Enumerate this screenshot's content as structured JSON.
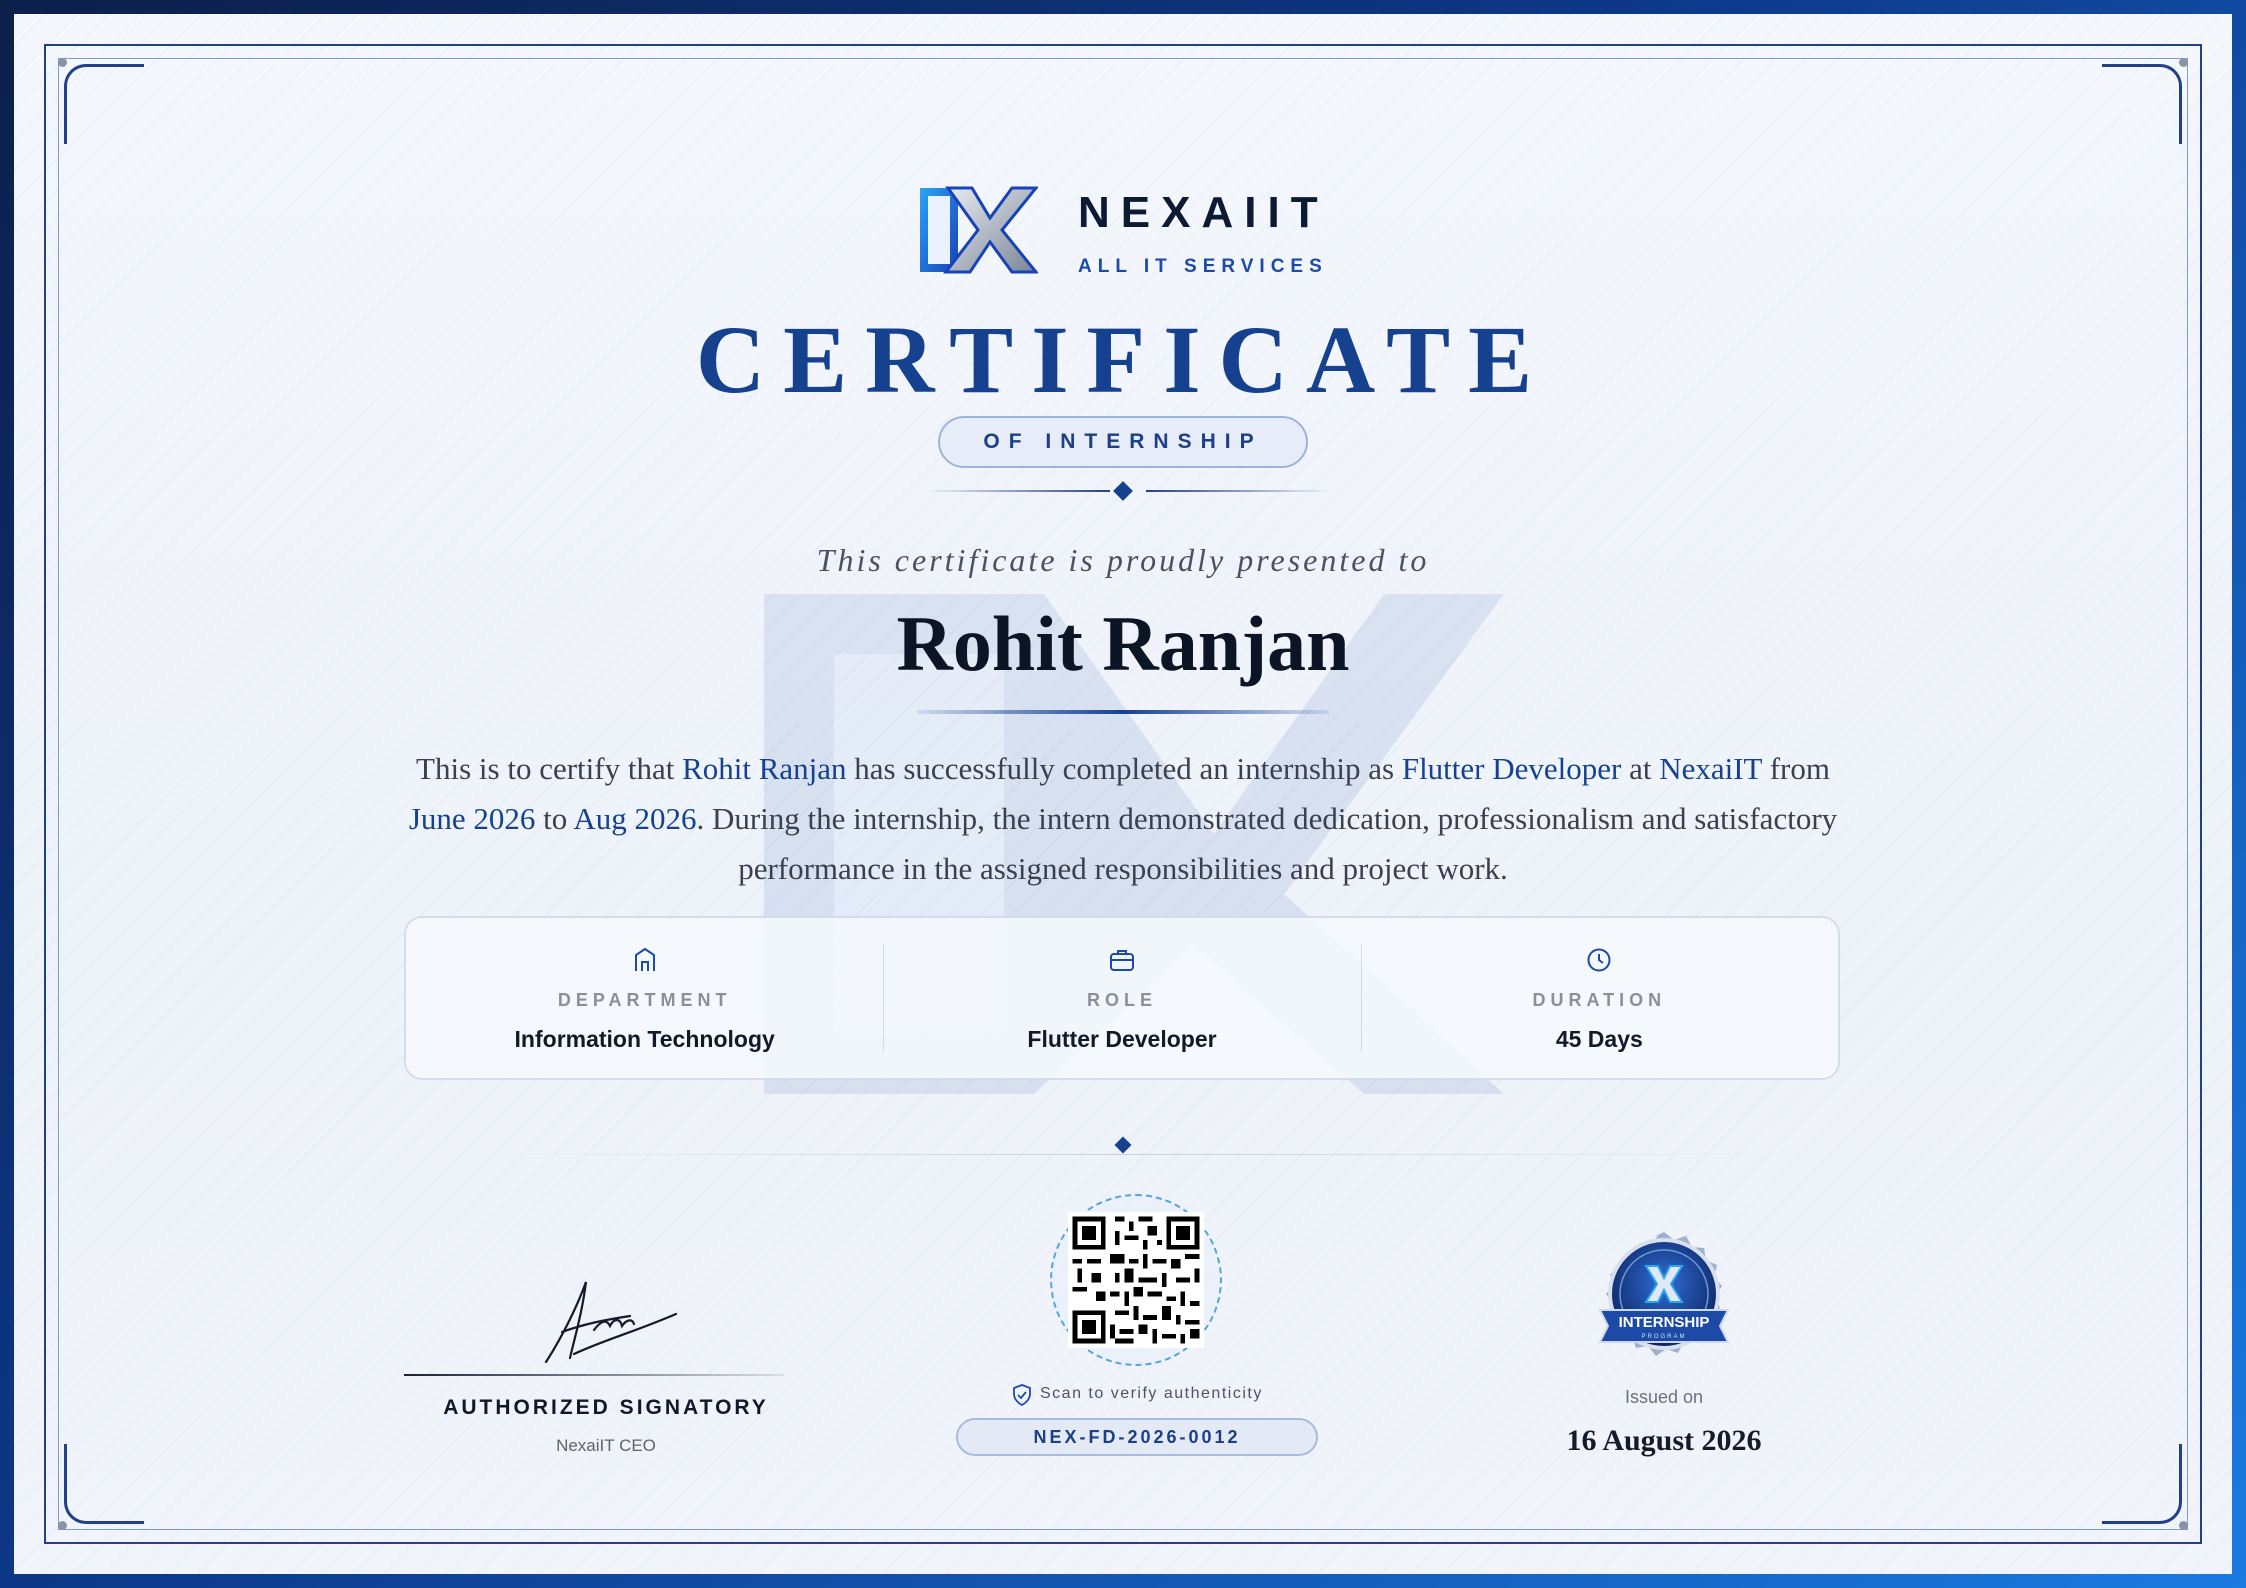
{
  "brand": {
    "name": "NEXAIIT",
    "tagline": "ALL IT SERVICES"
  },
  "certificate": {
    "title": "CERTIFICATE",
    "subtitle": "OF INTERNSHIP",
    "presented_text": "This certificate is proudly presented to",
    "recipient_name": "Rohit Ranjan",
    "body": {
      "p1": "This is to certify that ",
      "name": "Rohit Ranjan",
      "p2": " has successfully completed an internship as ",
      "role": "Flutter Developer",
      "p3": " at ",
      "company": "NexaiIT",
      "p4": " from ",
      "start": "June 2026",
      "p5": " to ",
      "end": "Aug 2026",
      "p6": ". During the internship, the intern demonstrated dedication, professionalism and satisfactory performance in the assigned responsibilities and project work."
    }
  },
  "details": [
    {
      "icon": "building-icon",
      "label": "DEPARTMENT",
      "value": "Information Technology"
    },
    {
      "icon": "briefcase-icon",
      "label": "ROLE",
      "value": "Flutter Developer"
    },
    {
      "icon": "clock-icon",
      "label": "DURATION",
      "value": "45 Days"
    }
  ],
  "signatory": {
    "title": "AUTHORIZED SIGNATORY",
    "subtitle": "NexaiIT CEO"
  },
  "verification": {
    "scan_text": "Scan to verify authenticity",
    "code": "NEX-FD-2026-0012"
  },
  "issue": {
    "label": "Issued on",
    "date": "16 August 2026"
  },
  "badge": {
    "text": "INTERNSHIP",
    "subtext": "PROGRAM"
  },
  "colors": {
    "primary": "#16418f",
    "accent": "#1a7ae0",
    "text_dark": "#0c1526"
  }
}
